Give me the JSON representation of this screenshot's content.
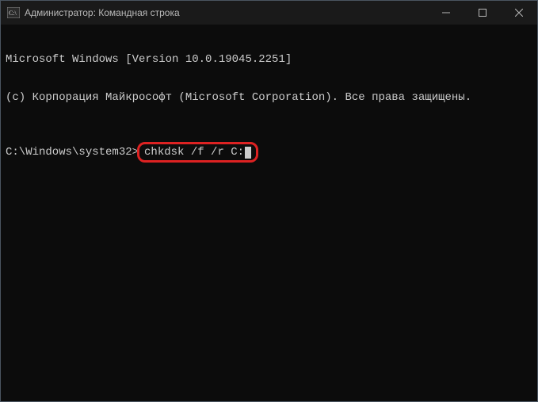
{
  "titlebar": {
    "title": "Администратор: Командная строка"
  },
  "terminal": {
    "line1": "Microsoft Windows [Version 10.0.19045.2251]",
    "line2": "(c) Корпорация Майкрософт (Microsoft Corporation). Все права защищены.",
    "prompt": "C:\\Windows\\system32>",
    "command": "chkdsk /f /r C:"
  }
}
